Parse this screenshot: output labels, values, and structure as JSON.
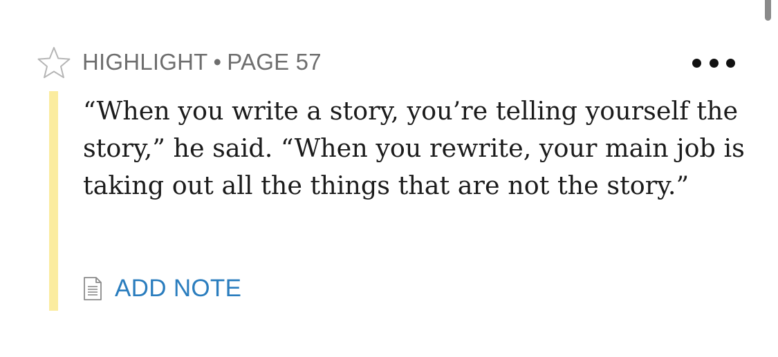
{
  "highlight": {
    "type_label": "HIGHLIGHT",
    "separator": "•",
    "page_label": "PAGE 57",
    "highlight_color": "#fbec9f",
    "quote_text": "“When you write a story, you’re telling yourself the story,” he said. “When you rewrite, your main job is taking out all the things that are not the story.”"
  },
  "actions": {
    "add_note_label": "ADD NOTE",
    "add_note_color": "#2a7dbe"
  },
  "icons": {
    "favorite": "star-outline-icon",
    "more": "more-horizontal-icon",
    "note": "document-icon"
  }
}
